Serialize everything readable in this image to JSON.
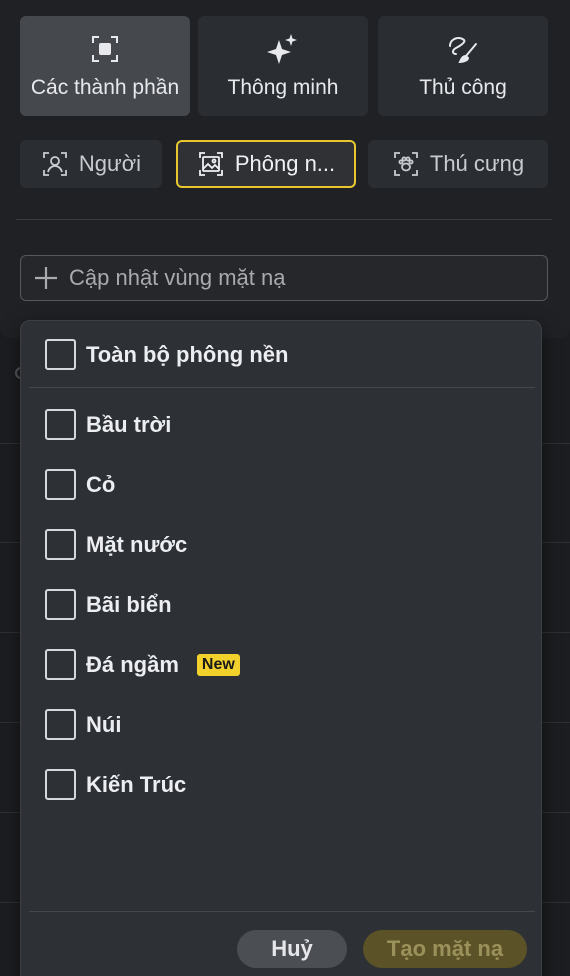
{
  "modes": [
    {
      "label": "Các thành phần",
      "icon": "target-square-icon",
      "active": true
    },
    {
      "label": "Thông minh",
      "icon": "sparkle-icon",
      "active": false
    },
    {
      "label": "Thủ công",
      "icon": "brush-icon",
      "active": false
    }
  ],
  "subjects": [
    {
      "label": "Người",
      "icon": "person-frame-icon",
      "active": false
    },
    {
      "label": "Phông n...",
      "icon": "image-frame-icon",
      "active": true
    },
    {
      "label": "Thú cưng",
      "icon": "paw-frame-icon",
      "active": false
    }
  ],
  "update_mask": {
    "label": "Cập nhật vùng mặt nạ",
    "icon": "plus-icon"
  },
  "dropdown": {
    "all_label": "Toàn bộ phông nền",
    "items": [
      {
        "label": "Bầu trời",
        "checked": false
      },
      {
        "label": "Cỏ",
        "checked": false
      },
      {
        "label": "Mặt nước",
        "checked": false
      },
      {
        "label": "Bãi biển",
        "checked": false
      },
      {
        "label": "Đá ngầm",
        "checked": false,
        "badge": "New"
      },
      {
        "label": "Núi",
        "checked": false
      },
      {
        "label": "Kiến Trúc",
        "checked": false
      }
    ],
    "cancel_label": "Huỷ",
    "create_label": "Tạo mặt nạ"
  },
  "colors": {
    "accent": "#e8c630",
    "badge": "#f2d12d",
    "create_disabled": "#5c5228"
  }
}
